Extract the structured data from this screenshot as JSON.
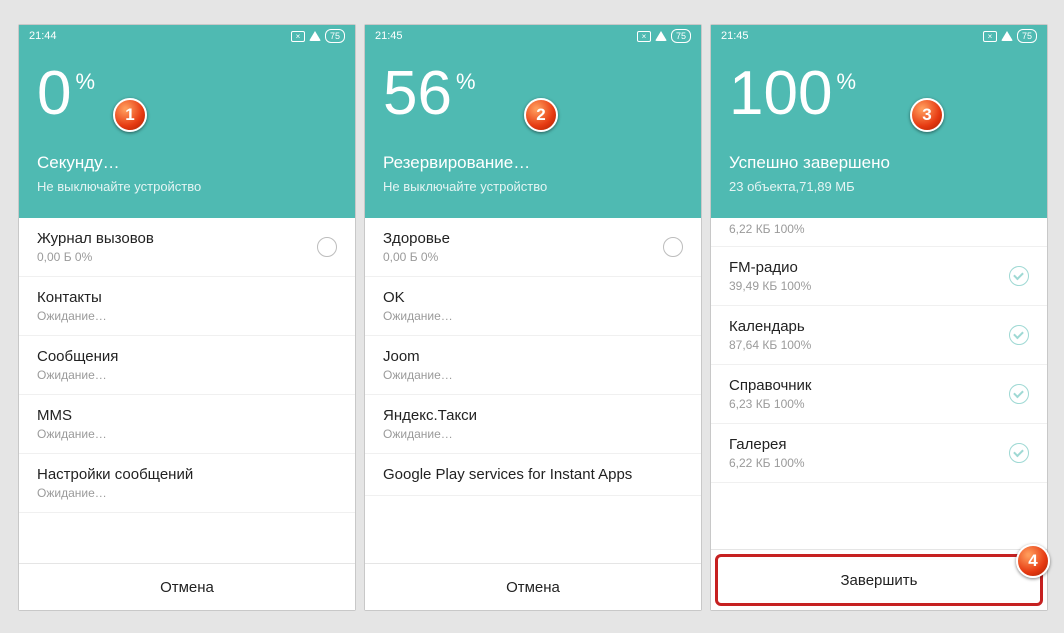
{
  "phones": [
    {
      "time": "21:44",
      "battery": "75",
      "percentValue": "0",
      "percentSign": "%",
      "title": "Секунду…",
      "subtitle": "Не выключайте устройство",
      "rows": [
        {
          "title": "Журнал вызовов",
          "sub": "0,00 Б 0%",
          "radio": true
        },
        {
          "title": "Контакты",
          "sub": "Ожидание…"
        },
        {
          "title": "Сообщения",
          "sub": "Ожидание…"
        },
        {
          "title": "MMS",
          "sub": "Ожидание…"
        },
        {
          "title": "Настройки сообщений",
          "sub": "Ожидание…"
        }
      ],
      "footer": "Отмена",
      "calloutNum": "1"
    },
    {
      "time": "21:45",
      "battery": "75",
      "percentValue": "56",
      "percentSign": "%",
      "title": "Резервирование…",
      "subtitle": "Не выключайте устройство",
      "rows": [
        {
          "title": "Здоровье",
          "sub": "0,00 Б 0%",
          "radio": true
        },
        {
          "title": "OK",
          "sub": "Ожидание…"
        },
        {
          "title": "Joom",
          "sub": "Ожидание…"
        },
        {
          "title": "Яндекс.Такси",
          "sub": "Ожидание…"
        },
        {
          "title": "Google Play services for Instant Apps",
          "sub": ""
        }
      ],
      "footer": "Отмена",
      "calloutNum": "2"
    },
    {
      "time": "21:45",
      "battery": "75",
      "percentValue": "100",
      "percentSign": "%",
      "title": "Успешно завершено",
      "subtitle": "23 объекта,71,89 МБ",
      "partialRowSub": "6,22 КБ 100%",
      "rows": [
        {
          "title": "FM-радио",
          "sub": "39,49 КБ 100%",
          "check": true
        },
        {
          "title": "Календарь",
          "sub": "87,64 КБ 100%",
          "check": true
        },
        {
          "title": "Справочник",
          "sub": "6,23 КБ 100%",
          "check": true
        },
        {
          "title": "Галерея",
          "sub": "6,22 КБ 100%",
          "check": true
        }
      ],
      "footer": "Завершить",
      "footerHighlight": true,
      "calloutNum": "3",
      "footerCallout": "4"
    }
  ]
}
